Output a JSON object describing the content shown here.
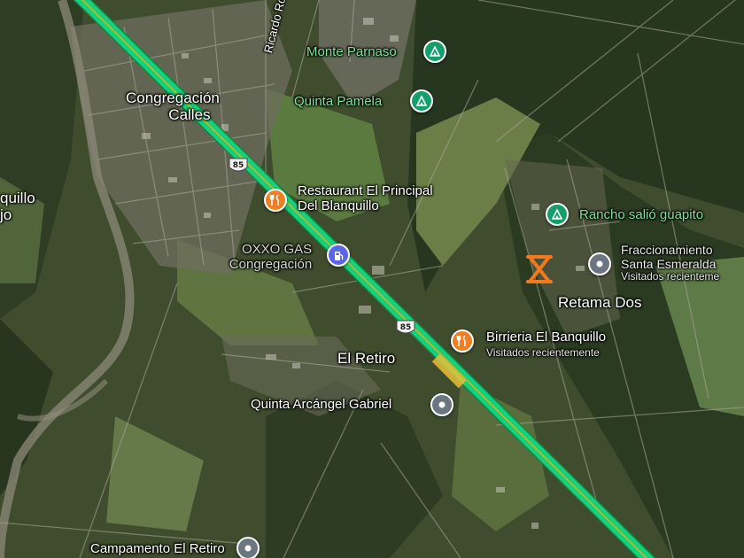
{
  "colors": {
    "highway": "#19d07a",
    "highway_edge": "#0a8a45",
    "highway_center": "#d4b422",
    "camp_pin": "#139e6c",
    "food_pin": "#ef7f24",
    "gas_pin": "#5b66e5",
    "generic_pin": "#6c7680",
    "marker": "#f27a1c"
  },
  "highway": {
    "shield_number": "85"
  },
  "places": {
    "monte_parnaso": "Monte Parnaso",
    "quinta_pamela": "Quinta Pamela",
    "congregacion_line1": "Congregación",
    "congregacion_line2": "Calles",
    "ricardo": "Ricardo Rodrígue",
    "restaurant_line1": "Restaurant El Principal",
    "restaurant_line2": "Del Blanquillo",
    "oxxo_line1": "OXXO GAS",
    "oxxo_line2": "Congregación",
    "blanquillo_line1": "quillo",
    "blanquillo_line2": "jo",
    "rancho": "Rancho salió guapito",
    "fracc_line1": "Fraccionamiento",
    "fracc_line2": "Santa Esmeralda",
    "fracc_sub": "Visitados recienteme",
    "retama": "Retama Dos",
    "birrieria": "Birrieria El Banquillo",
    "birrieria_sub": "Visitados recientemente",
    "el_retiro": "El Retiro",
    "quinta_arcangel": "Quinta Arcángel Gabriel",
    "campamento": "Campamento El Retiro"
  },
  "icons": {
    "camp": "campground-icon",
    "food": "restaurant-icon",
    "gas": "gas-station-icon",
    "generic": "place-pin-icon",
    "selected": "selected-location-marker"
  }
}
